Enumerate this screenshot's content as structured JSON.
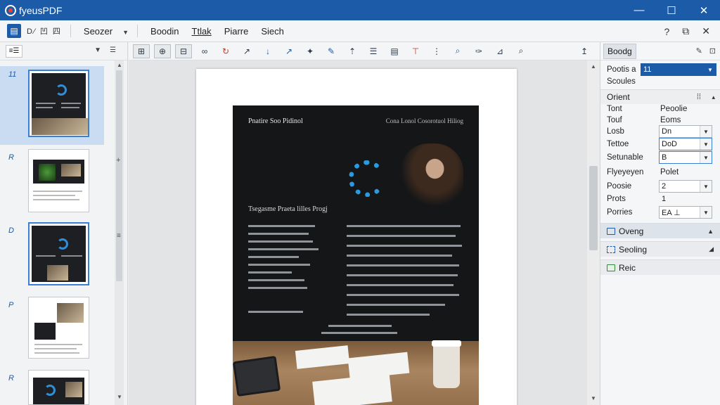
{
  "titlebar": {
    "title": "fyeusPDF",
    "logo_icon": "app-logo-icon",
    "minimize": "—",
    "maximize": "☐",
    "close": "✕"
  },
  "menubar": {
    "mode_icon": "file-text-icon",
    "quick_icons": "D⁄ 凹 四",
    "items": [
      {
        "label": "Seozer",
        "dropdown": true
      },
      {
        "label": "Boodin"
      },
      {
        "label": "Ttlak",
        "underline": true
      },
      {
        "label": "Piarre"
      },
      {
        "label": "Siech"
      }
    ],
    "right_icons": [
      "help-icon",
      "restore-icon",
      "close-doc-icon"
    ],
    "right_glyphs": [
      "?",
      "⧉",
      "✕"
    ]
  },
  "thumbnails": {
    "toolbar_label": "≡☰",
    "toolbar_icons": [
      "▼",
      "☰"
    ],
    "pages": [
      {
        "number": "11",
        "selected": true
      },
      {
        "number": "R"
      },
      {
        "number": "D",
        "outlined": true
      },
      {
        "number": "P"
      },
      {
        "number": "R"
      }
    ]
  },
  "toolbar": {
    "tools": [
      {
        "name": "select-tool",
        "glyph": "⊞",
        "boxed": true
      },
      {
        "name": "hand-tool",
        "glyph": "⊕",
        "boxed": true
      },
      {
        "name": "snapshot-tool",
        "glyph": "⊟",
        "boxed": true
      },
      {
        "name": "link-tool",
        "glyph": "∞"
      },
      {
        "name": "rotate-tool",
        "glyph": "↻",
        "red": true
      },
      {
        "name": "draw-tool",
        "glyph": "↗"
      },
      {
        "name": "arrow-down-tool",
        "glyph": "↓",
        "blue": true
      },
      {
        "name": "arrow-up-tool",
        "glyph": "↗",
        "blue": true
      },
      {
        "name": "magic-tool",
        "glyph": "✦"
      },
      {
        "name": "pen-tool",
        "glyph": "✎",
        "blue": true
      },
      {
        "name": "text-up-tool",
        "glyph": "⇡"
      },
      {
        "name": "list-tool",
        "glyph": "☰"
      },
      {
        "name": "page-tool",
        "glyph": "▤"
      },
      {
        "name": "crop-tool",
        "glyph": "⊤",
        "red": true
      },
      {
        "name": "grid-tool",
        "glyph": "⋮"
      },
      {
        "name": "search-tool",
        "glyph": "⌕",
        "blue": true
      },
      {
        "name": "edit-tool",
        "glyph": "✑"
      },
      {
        "name": "measure-tool",
        "glyph": "⊿"
      },
      {
        "name": "zoom-tool",
        "glyph": "⌕"
      },
      {
        "name": "pin-tool",
        "glyph": "↥"
      }
    ]
  },
  "document": {
    "poster_title": "Pnatire Soo Pidinol",
    "poster_subtitle": "Cona Lonol Cosorotuol Hiliog",
    "poster_heading": "Tsegasme Praeta lilles Progj"
  },
  "properties": {
    "tab": "Boodg",
    "head_icons": [
      "✎",
      "⊡"
    ],
    "rows": {
      "poots_label": "Pootis a",
      "poots_value": "11",
      "scoules": "Scoules",
      "orient": "Orient",
      "tont_label": "Tont",
      "tont_value": "Peoolie",
      "touf_label": "Touf",
      "touf_value": "Eoms",
      "losb_label": "Losb",
      "losb_value": "Dn",
      "tettoe_label": "Tettoe",
      "tettoe_value": "DoD",
      "setunable_label": "Setunable",
      "setunable_value": "B",
      "fiyecyon_label": "Flyeyeyen",
      "fiyecyon_value": "Polet",
      "poosie_label": "Poosie",
      "poosie_value": "2",
      "prots_label": "Prots",
      "prots_value": "1",
      "porries_label": "Porries",
      "porries_value": "EA ⊥"
    },
    "bands": [
      {
        "label": "Oveng",
        "arrow": "▲"
      },
      {
        "label": "Seoling",
        "arrow": "◢"
      },
      {
        "label": "Reic",
        "arrow": ""
      }
    ]
  }
}
